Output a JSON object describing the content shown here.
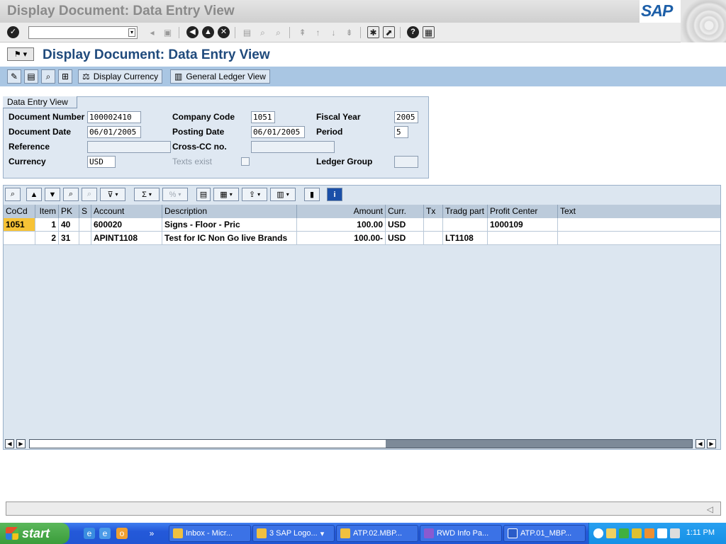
{
  "window": {
    "title": "Display Document: Data Entry View"
  },
  "brand": {
    "logo_text": "SAP"
  },
  "standard_toolbar": {
    "command_field_value": ""
  },
  "page": {
    "title": "Display Document: Data Entry View"
  },
  "app_toolbar": {
    "display_currency_label": "Display Currency",
    "general_ledger_view_label": "General Ledger View"
  },
  "header_group": {
    "tab_label": "Data Entry View",
    "document_number": {
      "label": "Document Number",
      "value": "100002410"
    },
    "document_date": {
      "label": "Document Date",
      "value": "06/01/2005"
    },
    "reference": {
      "label": "Reference",
      "value": ""
    },
    "currency": {
      "label": "Currency",
      "value": "USD"
    },
    "company_code": {
      "label": "Company Code",
      "value": "1051"
    },
    "posting_date": {
      "label": "Posting Date",
      "value": "06/01/2005"
    },
    "cross_cc": {
      "label": "Cross-CC no.",
      "value": ""
    },
    "texts_exist": {
      "label": "Texts exist",
      "checked": false
    },
    "fiscal_year": {
      "label": "Fiscal Year",
      "value": "2005"
    },
    "period": {
      "label": "Period",
      "value": "5"
    },
    "ledger_group": {
      "label": "Ledger Group",
      "value": ""
    }
  },
  "grid": {
    "columns": {
      "cocd": "CoCd",
      "item": "Item",
      "pk": "PK",
      "s": "S",
      "account": "Account",
      "description": "Description",
      "amount": "Amount",
      "curr": "Curr.",
      "tx": "Tx",
      "tradg_part": "Tradg part",
      "profit_center": "Profit Center",
      "text": "Text"
    },
    "rows": [
      {
        "cocd": "1051",
        "item": "1",
        "pk": "40",
        "s": "",
        "account": "600020",
        "description": "Signs - Floor - Pric",
        "amount": "100.00",
        "curr": "USD",
        "tx": "",
        "tradg_part": "",
        "profit_center": "1000109",
        "text": ""
      },
      {
        "cocd": "",
        "item": "2",
        "pk": "31",
        "s": "",
        "account": "APINT1108",
        "description": "Test for IC Non Go live Brands",
        "amount": "100.00-",
        "curr": "USD",
        "tx": "",
        "tradg_part": "LT1108",
        "profit_center": "",
        "text": ""
      }
    ]
  },
  "taskbar": {
    "start_label": "start",
    "tasks": [
      "Inbox - Micr...",
      "3 SAP Logo...",
      "ATP.02.MBP...",
      "RWD Info Pa...",
      "ATP.01_MBP..."
    ],
    "clock": "1:11 PM"
  },
  "colors": {
    "title_blue": "#1f4a7c",
    "app_toolbar": "#a9c6e3",
    "key_cell": "#f7c336",
    "taskbar": "#2459d9"
  }
}
